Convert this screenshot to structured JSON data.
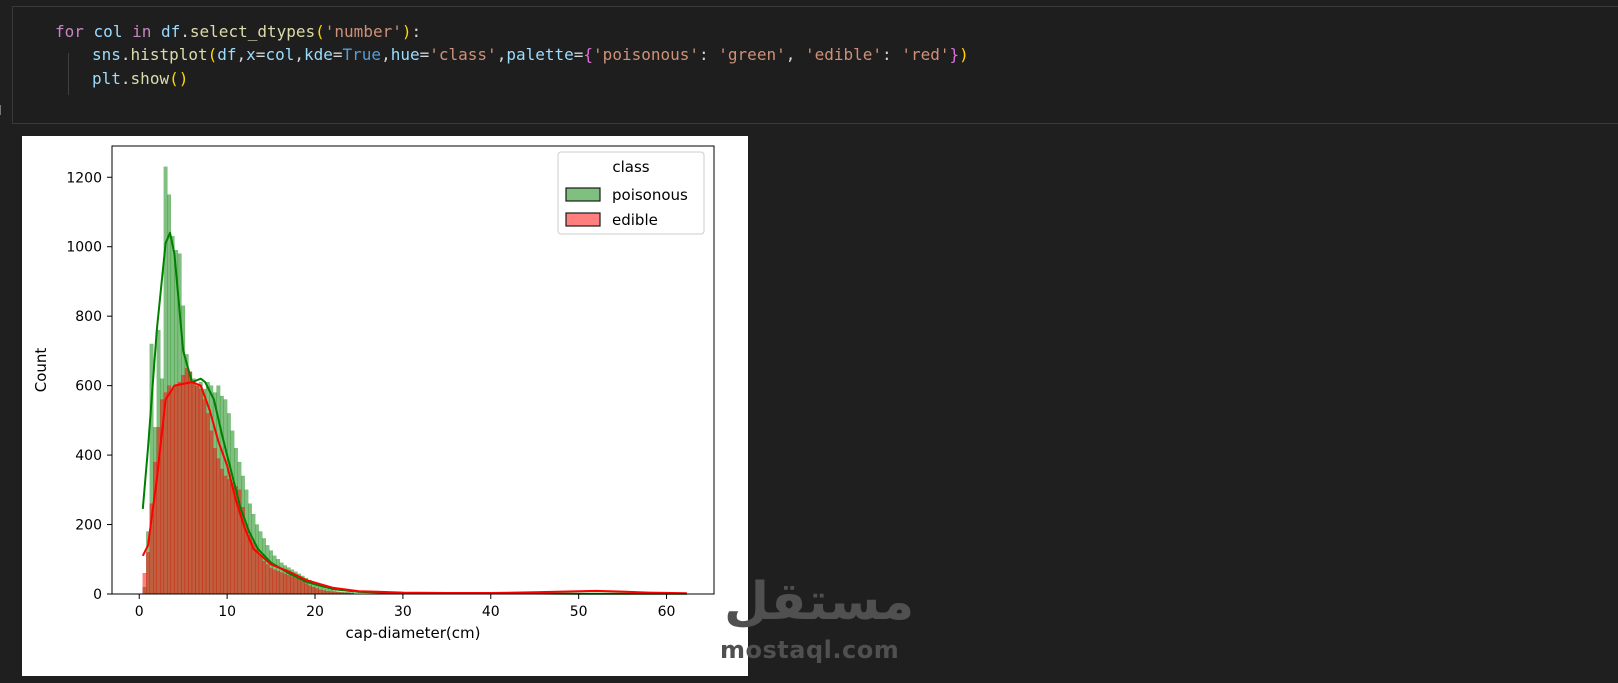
{
  "notebook": {
    "code": {
      "line1": {
        "kw_for": "for",
        "v_col": "col",
        "kw_in": "in",
        "v_df": "df",
        "dot1": ".",
        "fn_select": "select_dtypes",
        "p_open": "(",
        "s_number": "'number'",
        "p_close": ")",
        "colon": ":"
      },
      "line2": {
        "v_sns": "sns",
        "dot": ".",
        "fn_histplot": "histplot",
        "p_open": "(",
        "a_df": "df",
        "c1": ",",
        "a_x": "x",
        "eq1": "=",
        "a_col": "col",
        "c2": ",",
        "a_kde": "kde",
        "eq2": "=",
        "c_true": "True",
        "c3": ",",
        "a_hue": "hue",
        "eq3": "=",
        "s_class": "'class'",
        "c4": ",",
        "a_palette": "palette",
        "eq4": "=",
        "b_open": "{",
        "s_poisonous": "'poisonous'",
        "col1": ": ",
        "s_green": "'green'",
        "c5": ", ",
        "s_edible": "'edible'",
        "col2": ": ",
        "s_red": "'red'",
        "b_close": "}",
        "p_close": ")"
      },
      "line3": {
        "v_plt": "plt",
        "dot": ".",
        "fn_show": "show",
        "parens": "()"
      }
    },
    "watermark": {
      "glyph": "مستقل",
      "text": "mostaql.com"
    }
  },
  "chart_data": {
    "type": "histogram",
    "xlabel": "cap-diameter(cm)",
    "ylabel": "Count",
    "xlim": [
      -3.1,
      65.4
    ],
    "ylim": [
      0,
      1290
    ],
    "xticks": [
      "0",
      "10",
      "20",
      "30",
      "40",
      "50",
      "60"
    ],
    "yticks": [
      "0",
      "200",
      "400",
      "600",
      "800",
      "1000",
      "1200"
    ],
    "legend": {
      "title": "class",
      "placement": "top-right",
      "entries": [
        {
          "label": "poisonous",
          "fill": "#7fbf7f",
          "edge": "#1a1a1a"
        },
        {
          "label": "edible",
          "fill": "#ff7f7f",
          "edge": "#1a1a1a"
        }
      ]
    },
    "grid": false,
    "bin_edges_start": 0.4,
    "bin_width": 0.4,
    "series": [
      {
        "name": "poisonous",
        "color": "green",
        "fill": "rgba(0,128,0,0.5)",
        "bins": [
          20,
          180,
          720,
          480,
          760,
          620,
          1230,
          1150,
          1030,
          990,
          980,
          830,
          690,
          640,
          620,
          600,
          610,
          590,
          610,
          600,
          580,
          600,
          570,
          560,
          520,
          470,
          420,
          380,
          340,
          300,
          260,
          230,
          200,
          180,
          160,
          140,
          125,
          110,
          100,
          90,
          82,
          76,
          70,
          64,
          58,
          52,
          46,
          40,
          34,
          28,
          22,
          18,
          14,
          11,
          9,
          7,
          6,
          5,
          5,
          4
        ],
        "kde": [
          [
            0.4,
            245
          ],
          [
            1.0,
            420
          ],
          [
            2.0,
            760
          ],
          [
            3.0,
            1010
          ],
          [
            3.5,
            1040
          ],
          [
            4.0,
            980
          ],
          [
            5.0,
            700
          ],
          [
            6.0,
            610
          ],
          [
            7.0,
            620
          ],
          [
            7.5,
            610
          ],
          [
            8.5,
            560
          ],
          [
            9.5,
            450
          ],
          [
            10.5,
            350
          ],
          [
            11.5,
            250
          ],
          [
            12.5,
            180
          ],
          [
            13.5,
            130
          ],
          [
            15,
            90
          ],
          [
            17,
            60
          ],
          [
            19,
            35
          ],
          [
            22,
            14
          ],
          [
            25,
            6
          ],
          [
            30,
            3
          ],
          [
            40,
            2
          ],
          [
            50,
            1
          ],
          [
            62.3,
            1
          ]
        ]
      },
      {
        "name": "edible",
        "color": "red",
        "fill": "rgba(255,0,0,0.5)",
        "bins": [
          60,
          120,
          260,
          380,
          480,
          560,
          580,
          600,
          590,
          600,
          610,
          630,
          650,
          640,
          610,
          600,
          590,
          560,
          520,
          470,
          420,
          390,
          360,
          340,
          330,
          320,
          310,
          300,
          250,
          200,
          170,
          150,
          130,
          110,
          95,
          85,
          75,
          70,
          66,
          62,
          58,
          54,
          50,
          46,
          42,
          36,
          30,
          24,
          20,
          16,
          12,
          10,
          8,
          7,
          6,
          5,
          4,
          3,
          3,
          2
        ],
        "kde": [
          [
            0.4,
            110
          ],
          [
            1.0,
            140
          ],
          [
            2.0,
            330
          ],
          [
            3.0,
            560
          ],
          [
            4.0,
            600
          ],
          [
            5.0,
            605
          ],
          [
            6.0,
            610
          ],
          [
            7.0,
            600
          ],
          [
            8.0,
            530
          ],
          [
            9.0,
            440
          ],
          [
            10,
            370
          ],
          [
            11,
            270
          ],
          [
            12,
            190
          ],
          [
            13,
            130
          ],
          [
            15,
            85
          ],
          [
            17,
            65
          ],
          [
            19,
            40
          ],
          [
            22,
            18
          ],
          [
            25,
            8
          ],
          [
            30,
            4
          ],
          [
            35,
            3
          ],
          [
            40,
            3
          ],
          [
            45,
            5
          ],
          [
            50,
            8
          ],
          [
            52,
            9
          ],
          [
            55,
            7
          ],
          [
            58,
            4
          ],
          [
            62.3,
            2
          ]
        ]
      }
    ]
  }
}
